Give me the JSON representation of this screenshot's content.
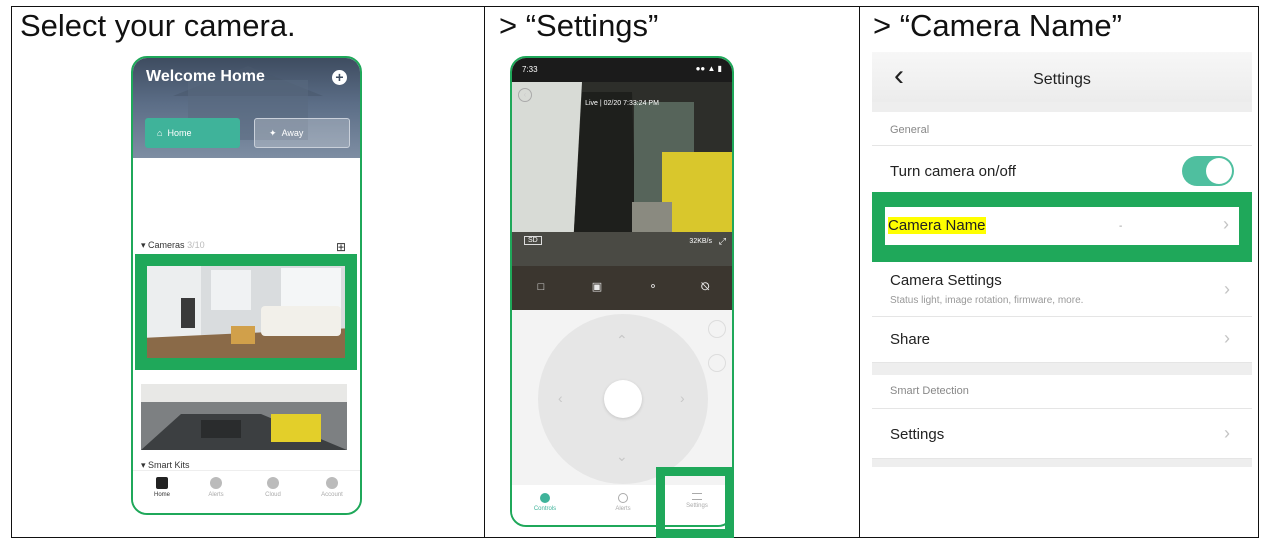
{
  "columns": [
    {
      "title": "Select your camera."
    },
    {
      "title": "> “Settings”"
    },
    {
      "title": "> “Camera Name”"
    }
  ],
  "phone1": {
    "header_title": "Welcome Home",
    "mode_home": "Home",
    "mode_away": "Away",
    "cameras_section": "Cameras",
    "cameras_count": "3/10",
    "smart_kits_section": "Smart Kits",
    "tabs": [
      "Home",
      "Alerts",
      "Cloud",
      "Account"
    ],
    "icons": {
      "add": "plus-icon",
      "grid": "grid-view-icon"
    }
  },
  "phone2": {
    "status_time": "7:33",
    "live_label": "Live | 02/20 7:33:24 PM",
    "quality": "SD",
    "bitrate": "32KB/s",
    "tabs": [
      "Controls",
      "Alerts",
      "Settings"
    ]
  },
  "settings": {
    "nav_title": "Settings",
    "general_header": "General",
    "turn_camera": "Turn camera on/off",
    "toggle_on": true,
    "camera_name": "Camera Name",
    "camera_settings": "Camera Settings",
    "camera_settings_sub": "Status light, image rotation, firmware, more.",
    "share": "Share",
    "smart_detection_header": "Smart Detection",
    "sd_settings": "Settings",
    "accent_color": "#1fa85a",
    "toggle_color": "#4fbf9f",
    "marker_color": "#ffff00"
  }
}
